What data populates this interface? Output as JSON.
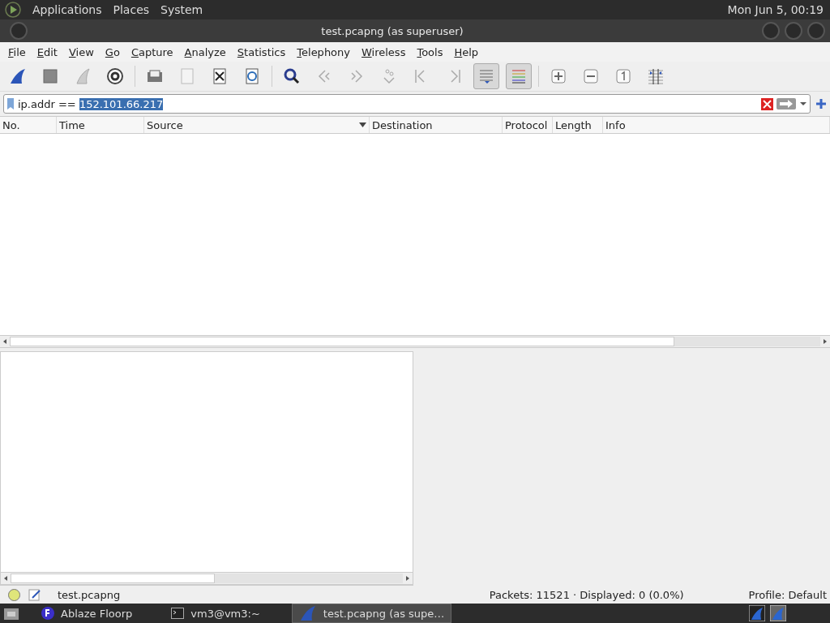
{
  "top_panel": {
    "menus": [
      "Applications",
      "Places",
      "System"
    ],
    "clock": "Mon Jun  5, 00:19"
  },
  "window": {
    "title": "test.pcapng (as superuser)"
  },
  "menubar": [
    "File",
    "Edit",
    "View",
    "Go",
    "Capture",
    "Analyze",
    "Statistics",
    "Telephony",
    "Wireless",
    "Tools",
    "Help"
  ],
  "toolbar": {
    "autoscroll_pressed": true,
    "colorize_pressed": true
  },
  "filter": {
    "prefix": "ip.addr == ",
    "selected_text": "152.101.66.217"
  },
  "packet_list": {
    "columns": [
      {
        "label": "No.",
        "sorted": false
      },
      {
        "label": "Time",
        "sorted": false
      },
      {
        "label": "Source",
        "sorted": true
      },
      {
        "label": "Destination",
        "sorted": false
      },
      {
        "label": "Protocol",
        "sorted": false
      },
      {
        "label": "Length",
        "sorted": false
      },
      {
        "label": "Info",
        "sorted": false
      }
    ]
  },
  "status_bar": {
    "file": "test.pcapng",
    "packets": "Packets: 11521 · Displayed: 0 (0.0%)",
    "profile": "Profile: Default"
  },
  "taskbar": [
    {
      "label": "Ablaze Floorp",
      "kind": "browser",
      "selected": false
    },
    {
      "label": "vm3@vm3:~",
      "kind": "terminal",
      "selected": false
    },
    {
      "label": "test.pcapng (as supe…",
      "kind": "shark",
      "selected": true
    }
  ]
}
